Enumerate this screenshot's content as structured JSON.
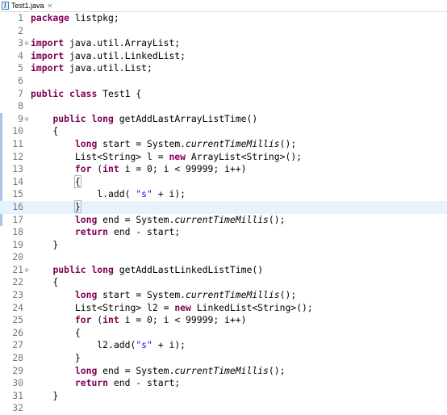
{
  "tab": {
    "title": "Test1.java",
    "close": "✕",
    "icon_letter": "J"
  },
  "lines": [
    {
      "n": "1",
      "tokens": [
        {
          "t": "package",
          "c": "kw"
        },
        {
          "t": " listpkg;"
        }
      ]
    },
    {
      "n": "2",
      "tokens": []
    },
    {
      "n": "3",
      "fold": "⊖",
      "tokens": [
        {
          "t": "import",
          "c": "kw"
        },
        {
          "t": " java.util.ArrayList;"
        }
      ]
    },
    {
      "n": "4",
      "tokens": [
        {
          "t": "import",
          "c": "kw"
        },
        {
          "t": " java.util.LinkedList;"
        }
      ]
    },
    {
      "n": "5",
      "tokens": [
        {
          "t": "import",
          "c": "kw"
        },
        {
          "t": " java.util.List;"
        }
      ]
    },
    {
      "n": "6",
      "tokens": []
    },
    {
      "n": "7",
      "tokens": [
        {
          "t": "public",
          "c": "kw"
        },
        {
          "t": " "
        },
        {
          "t": "class",
          "c": "kw"
        },
        {
          "t": " Test1 {"
        }
      ]
    },
    {
      "n": "8",
      "tokens": []
    },
    {
      "n": "9",
      "fold": "⊖",
      "tokens": [
        {
          "t": "    "
        },
        {
          "t": "public",
          "c": "kw"
        },
        {
          "t": " "
        },
        {
          "t": "long",
          "c": "kw"
        },
        {
          "t": " getAddLastArrayListTime()"
        }
      ]
    },
    {
      "n": "10",
      "tokens": [
        {
          "t": "    {"
        }
      ]
    },
    {
      "n": "11",
      "tokens": [
        {
          "t": "        "
        },
        {
          "t": "long",
          "c": "kw"
        },
        {
          "t": " start = System."
        },
        {
          "t": "currentTimeMillis",
          "c": "it"
        },
        {
          "t": "();"
        }
      ]
    },
    {
      "n": "12",
      "tokens": [
        {
          "t": "        List<String> l = "
        },
        {
          "t": "new",
          "c": "kw"
        },
        {
          "t": " ArrayList<String>();"
        }
      ]
    },
    {
      "n": "13",
      "tokens": [
        {
          "t": "        "
        },
        {
          "t": "for",
          "c": "kw"
        },
        {
          "t": " ("
        },
        {
          "t": "int",
          "c": "kw"
        },
        {
          "t": " i = 0; i < 99999; i++)"
        }
      ]
    },
    {
      "n": "14",
      "tokens": [
        {
          "t": "        "
        },
        {
          "t": "{",
          "c": "bracket-box"
        }
      ]
    },
    {
      "n": "15",
      "tokens": [
        {
          "t": "            l.add( "
        },
        {
          "t": "\"s\"",
          "c": "str"
        },
        {
          "t": " + i);"
        }
      ]
    },
    {
      "n": "16",
      "current": true,
      "tokens": [
        {
          "t": "        "
        },
        {
          "t": "}",
          "c": "bracket-box"
        },
        {
          "t": "",
          "c": "caret"
        }
      ]
    },
    {
      "n": "17",
      "tokens": [
        {
          "t": "        "
        },
        {
          "t": "long",
          "c": "kw"
        },
        {
          "t": " end = System."
        },
        {
          "t": "currentTimeMillis",
          "c": "it"
        },
        {
          "t": "();"
        }
      ]
    },
    {
      "n": "18",
      "tokens": [
        {
          "t": "        "
        },
        {
          "t": "return",
          "c": "kw"
        },
        {
          "t": " end - start;"
        }
      ]
    },
    {
      "n": "19",
      "tokens": [
        {
          "t": "    }"
        }
      ]
    },
    {
      "n": "20",
      "tokens": []
    },
    {
      "n": "21",
      "fold": "⊖",
      "tokens": [
        {
          "t": "    "
        },
        {
          "t": "public",
          "c": "kw"
        },
        {
          "t": " "
        },
        {
          "t": "long",
          "c": "kw"
        },
        {
          "t": " getAddLastLinkedListTime()"
        }
      ]
    },
    {
      "n": "22",
      "tokens": [
        {
          "t": "    {"
        }
      ]
    },
    {
      "n": "23",
      "tokens": [
        {
          "t": "        "
        },
        {
          "t": "long",
          "c": "kw"
        },
        {
          "t": " start = System."
        },
        {
          "t": "currentTimeMillis",
          "c": "it"
        },
        {
          "t": "();"
        }
      ]
    },
    {
      "n": "24",
      "tokens": [
        {
          "t": "        List<String> l2 = "
        },
        {
          "t": "new",
          "c": "kw"
        },
        {
          "t": " LinkedList<String>();"
        }
      ]
    },
    {
      "n": "25",
      "tokens": [
        {
          "t": "        "
        },
        {
          "t": "for",
          "c": "kw"
        },
        {
          "t": " ("
        },
        {
          "t": "int",
          "c": "kw"
        },
        {
          "t": " i = 0; i < 99999; i++)"
        }
      ]
    },
    {
      "n": "26",
      "tokens": [
        {
          "t": "        {"
        }
      ]
    },
    {
      "n": "27",
      "tokens": [
        {
          "t": "            l2.add("
        },
        {
          "t": "\"s\"",
          "c": "str"
        },
        {
          "t": " + i);"
        }
      ]
    },
    {
      "n": "28",
      "tokens": [
        {
          "t": "        }"
        }
      ]
    },
    {
      "n": "29",
      "tokens": [
        {
          "t": "        "
        },
        {
          "t": "long",
          "c": "kw"
        },
        {
          "t": " end = System."
        },
        {
          "t": "currentTimeMillis",
          "c": "it"
        },
        {
          "t": "();"
        }
      ]
    },
    {
      "n": "30",
      "tokens": [
        {
          "t": "        "
        },
        {
          "t": "return",
          "c": "kw"
        },
        {
          "t": " end - start;"
        }
      ]
    },
    {
      "n": "31",
      "tokens": [
        {
          "t": "    }"
        }
      ]
    },
    {
      "n": "32",
      "tokens": []
    }
  ],
  "colors": {
    "keyword": "#7f0055",
    "string": "#2a00ff",
    "line_number": "#787878",
    "current_line": "#e8f2fe",
    "change_marker": "#a9c6e6"
  }
}
